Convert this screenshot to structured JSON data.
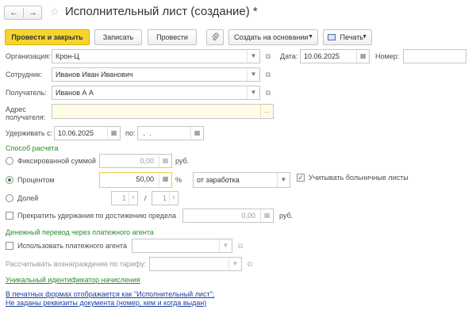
{
  "window": {
    "title": "Исполнительный лист (создание) *"
  },
  "nav": {
    "back_icon": "arrow-left",
    "forward_icon": "arrow-right",
    "favorite_icon": "star"
  },
  "toolbar": {
    "post_close": "Провести и закрыть",
    "save": "Записать",
    "post": "Провести",
    "attach_icon": "paperclip",
    "create_based": "Создать на основании",
    "print": "Печать"
  },
  "form": {
    "organization": {
      "label": "Организация:",
      "value": "Крон-Ц"
    },
    "date": {
      "label": "Дата:",
      "value": "10.06.2025"
    },
    "number": {
      "label": "Номер:",
      "value": ""
    },
    "employee": {
      "label": "Сотрудник:",
      "value": "Иванов Иван Иванович"
    },
    "recipient": {
      "label": "Получатель:",
      "value": "Иванов А А"
    },
    "address": {
      "label_line1": "Адрес",
      "label_line2": "получателя:",
      "value": ""
    },
    "withhold_from": {
      "label": "Удерживать с:",
      "value": "10.06.2025"
    },
    "withhold_to": {
      "label": "по:",
      "value": " .  . "
    }
  },
  "calc": {
    "section": "Способ расчета",
    "fixed": {
      "label": "Фиксированной суммой",
      "value": "0,00",
      "unit": "руб.",
      "selected": false
    },
    "percent": {
      "label": "Процентом",
      "value": "50,00",
      "unit": "%",
      "selected": true,
      "base": "от заработка"
    },
    "sick_leave": {
      "label": "Учитывать больничные листы",
      "checked": true
    },
    "share": {
      "label": "Долей",
      "num": "1",
      "sep": "/",
      "den": "1",
      "selected": false
    },
    "stop_limit": {
      "label": "Прекратить удержания по достижению предела",
      "value": "0,00",
      "unit": "руб.",
      "checked": false
    }
  },
  "agent": {
    "section": "Денежный перевод через платежного агента",
    "use_agent": {
      "label": "Использовать платежного агента",
      "value": "",
      "checked": false
    },
    "fee": {
      "label": "Рассчитывать вознаграждение по тарифу:",
      "value": ""
    }
  },
  "links": {
    "uid": "Уникальный идентификатор начисления",
    "print_forms": "В печатных формах отображается как \"Исполнительный лист\";",
    "doc_details": "Не заданы реквизиты документа (номер, кем и когда выдан)"
  },
  "colors": {
    "accent": "#f5d430",
    "section_green": "#2e8b2e",
    "link_blue": "#1b3fa8"
  }
}
